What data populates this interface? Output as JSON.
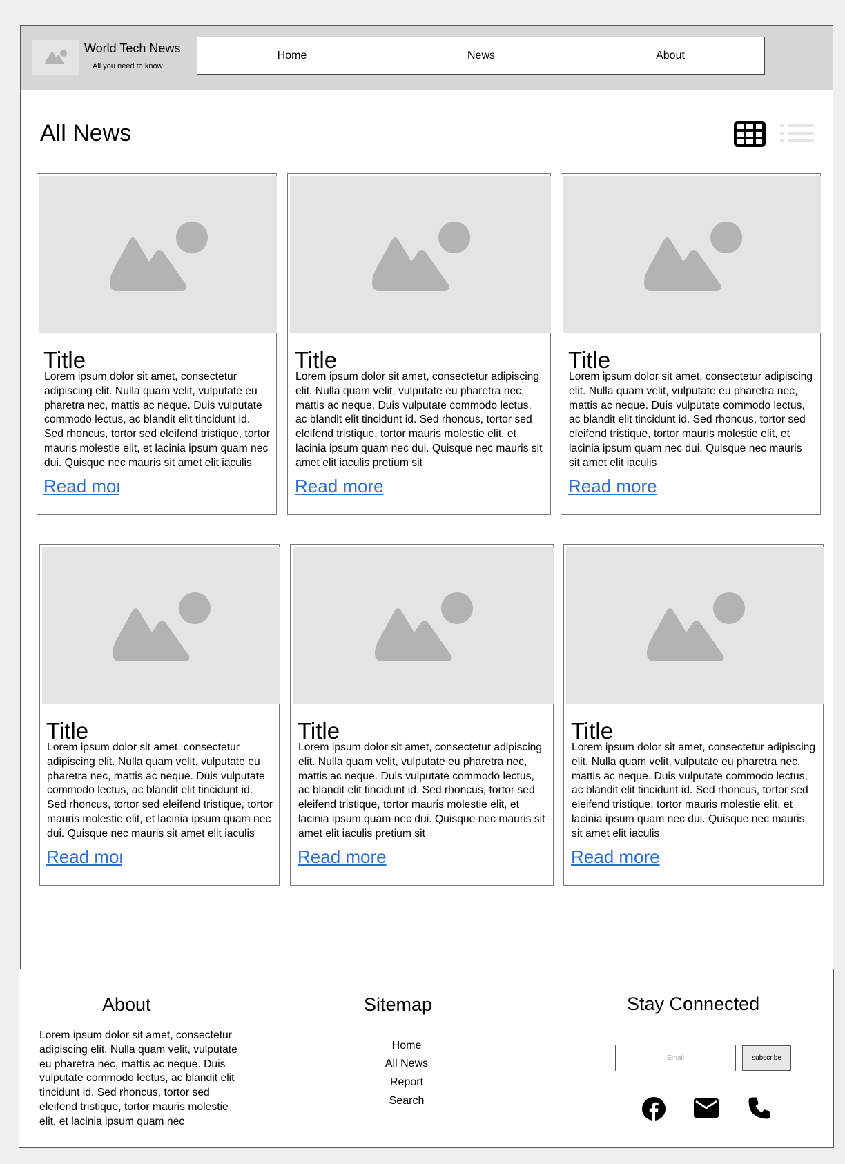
{
  "header": {
    "brand_title": "World Tech News",
    "brand_tagline": "All you need to know",
    "logo_icon": "image-placeholder-icon",
    "nav": [
      {
        "label": "Home"
      },
      {
        "label": "News"
      },
      {
        "label": "About"
      }
    ]
  },
  "main": {
    "title": "All News",
    "view_toggle": {
      "grid_icon": "grid-view-icon",
      "list_icon": "list-view-icon",
      "active": "grid"
    },
    "cards": [
      {
        "title": "Title",
        "body": "Lorem ipsum dolor sit amet, consectetur adipiscing elit. Nulla quam velit, vulputate eu pharetra nec, mattis ac neque. Duis vulputate commodo lectus, ac blandit elit tincidunt id. Sed rhoncus, tortor sed eleifend tristique, tortor mauris molestie elit, et lacinia ipsum quam nec dui. Quisque nec mauris sit amet elit iaculis pretium sit",
        "link": "Read more"
      },
      {
        "title": "Title",
        "body": "Lorem ipsum dolor sit amet, consectetur adipiscing elit. Nulla quam velit, vulputate eu pharetra nec, mattis ac neque. Duis vulputate commodo lectus, ac blandit elit tincidunt id. Sed rhoncus, tortor sed eleifend tristique, tortor mauris molestie elit, et lacinia ipsum quam nec dui. Quisque nec mauris sit amet elit iaculis pretium sit",
        "link": "Read more"
      },
      {
        "title": "Title",
        "body": "Lorem ipsum dolor sit amet, consectetur adipiscing elit. Nulla quam velit, vulputate eu pharetra nec, mattis ac neque. Duis vulputate commodo lectus, ac blandit elit tincidunt id. Sed rhoncus, tortor sed eleifend tristique, tortor mauris molestie elit, et lacinia ipsum quam nec dui. Quisque nec mauris sit amet elit iaculis",
        "link": "Read more"
      },
      {
        "title": "Title",
        "body": "Lorem ipsum dolor sit amet, consectetur adipiscing elit. Nulla quam velit, vulputate eu pharetra nec, mattis ac neque. Duis vulputate commodo lectus, ac blandit elit tincidunt id. Sed rhoncus, tortor sed eleifend tristique, tortor mauris molestie elit, et lacinia ipsum quam nec dui. Quisque nec mauris sit amet elit iaculis pretium sit",
        "link": "Read more"
      },
      {
        "title": "Title",
        "body": "Lorem ipsum dolor sit amet, consectetur adipiscing elit. Nulla quam velit, vulputate eu pharetra nec, mattis ac neque. Duis vulputate commodo lectus, ac blandit elit tincidunt id. Sed rhoncus, tortor sed eleifend tristique, tortor mauris molestie elit, et lacinia ipsum quam nec dui. Quisque nec mauris sit amet elit iaculis pretium sit",
        "link": "Read more"
      },
      {
        "title": "Title",
        "body": "Lorem ipsum dolor sit amet, consectetur adipiscing elit. Nulla quam velit, vulputate eu pharetra nec, mattis ac neque. Duis vulputate commodo lectus, ac blandit elit tincidunt id. Sed rhoncus, tortor sed eleifend tristique, tortor mauris molestie elit, et lacinia ipsum quam nec dui. Quisque nec mauris sit amet elit iaculis",
        "link": "Read more"
      }
    ]
  },
  "footer": {
    "about_title": "About",
    "about_text": "Lorem ipsum dolor sit amet, consectetur adipiscing elit. Nulla quam velit, vulputate eu pharetra nec, mattis ac neque. Duis vulputate commodo lectus, ac blandit elit tincidunt id. Sed rhoncus, tortor sed eleifend tristique, tortor mauris molestie elit, et lacinia ipsum quam nec",
    "sitemap_title": "Sitemap",
    "sitemap": [
      {
        "label": "Home"
      },
      {
        "label": "All News"
      },
      {
        "label": "Report"
      },
      {
        "label": "Search"
      }
    ],
    "connect_title": "Stay Connected",
    "email_placeholder": "Email",
    "subscribe_label": "subscribe",
    "social_icons": [
      "facebook-icon",
      "mail-icon",
      "phone-icon"
    ]
  },
  "colors": {
    "header_bg": "#d6d6d6",
    "image_placeholder_bg": "#e4e4e4",
    "image_placeholder_fg": "#b3b3b3",
    "link": "#2a6fd4"
  }
}
